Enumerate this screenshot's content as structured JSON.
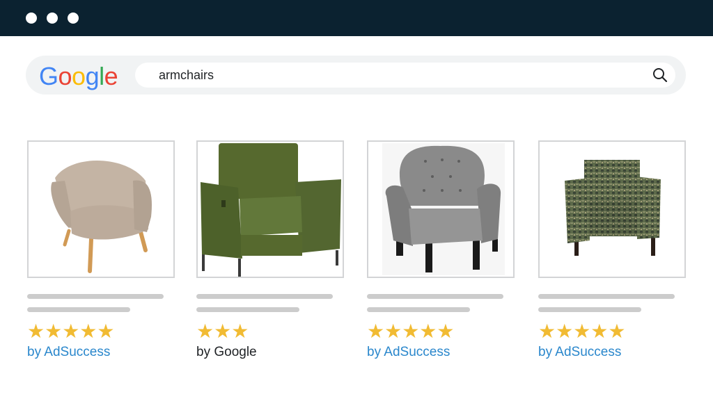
{
  "browser": {
    "window_dots": 3
  },
  "search": {
    "logo_letters": [
      "G",
      "o",
      "o",
      "g",
      "l",
      "e"
    ],
    "logo_colors": [
      "#4285F4",
      "#EA4335",
      "#FBBC05",
      "#4285F4",
      "#34A853",
      "#EA4335"
    ],
    "query": "armchairs",
    "icon": "search-icon"
  },
  "results": [
    {
      "product": "beige-armchair",
      "rating": 5,
      "stars": "★★★★★",
      "source": "by AdSuccess",
      "source_color": "#2a87cc"
    },
    {
      "product": "green-recliner-armchair",
      "rating": 3,
      "stars": "★★★",
      "source": "by Google",
      "source_color": "#1f2225"
    },
    {
      "product": "grey-tufted-armchair",
      "rating": 5,
      "stars": "★★★★★",
      "source": "by AdSuccess",
      "source_color": "#2a87cc"
    },
    {
      "product": "patterned-armchair",
      "rating": 5,
      "stars": "★★★★★",
      "source": "by AdSuccess",
      "source_color": "#2a87cc"
    }
  ],
  "colors": {
    "titlebar": "#0b2230",
    "star": "#f1bb33",
    "placeholder_line": "#cccccc"
  }
}
